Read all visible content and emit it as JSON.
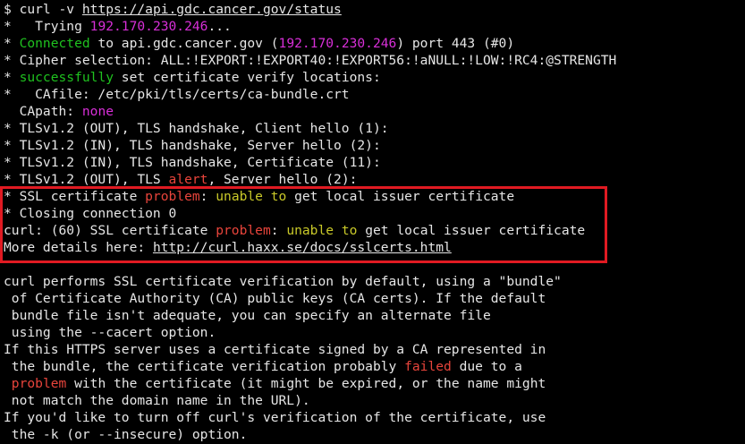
{
  "colors": {
    "background": "#000000",
    "text": "#e6e6e6",
    "green": "#1fc21f",
    "magenta": "#d82fd8",
    "red": "#e8443b",
    "yellow": "#c9c929",
    "highlight_border": "#e01a22"
  },
  "terminal": {
    "lines": [
      [
        {
          "t": "$ curl -v ",
          "c": "w"
        },
        {
          "t": "https://api.gdc.cancer.gov/status",
          "c": "w",
          "u": true
        }
      ],
      [
        {
          "t": "*   Trying ",
          "c": "w"
        },
        {
          "t": "192.170.230.246",
          "c": "m"
        },
        {
          "t": "...",
          "c": "w"
        }
      ],
      [
        {
          "t": "* ",
          "c": "w"
        },
        {
          "t": "Connected",
          "c": "g"
        },
        {
          "t": " to api.gdc.cancer.gov (",
          "c": "w"
        },
        {
          "t": "192.170.230.246",
          "c": "m"
        },
        {
          "t": ") port 443 (#0)",
          "c": "w"
        }
      ],
      [
        {
          "t": "* Cipher selection: ALL:!EXPORT:!EXPORT40:!EXPORT56:!aNULL:!LOW:!RC4:@STRENGTH",
          "c": "w"
        }
      ],
      [
        {
          "t": "* ",
          "c": "w"
        },
        {
          "t": "successfully",
          "c": "g"
        },
        {
          "t": " set certificate verify locations:",
          "c": "w"
        }
      ],
      [
        {
          "t": "*   CAfile: /etc/pki/tls/certs/ca-bundle.crt",
          "c": "w"
        }
      ],
      [
        {
          "t": "  CApath: ",
          "c": "w"
        },
        {
          "t": "none",
          "c": "m"
        }
      ],
      [
        {
          "t": "* TLSv1.2 (OUT), TLS handshake, Client hello (1):",
          "c": "w"
        }
      ],
      [
        {
          "t": "* TLSv1.2 (IN), TLS handshake, Server hello (2):",
          "c": "w"
        }
      ],
      [
        {
          "t": "* TLSv1.2 (IN), TLS handshake, Certificate (11):",
          "c": "w"
        }
      ],
      [
        {
          "t": "* TLSv1.2 (OUT), TLS ",
          "c": "w"
        },
        {
          "t": "alert",
          "c": "r"
        },
        {
          "t": ", Server hello (2):",
          "c": "w"
        }
      ],
      [
        {
          "t": "* SSL certificate ",
          "c": "w"
        },
        {
          "t": "problem",
          "c": "r"
        },
        {
          "t": ": ",
          "c": "w"
        },
        {
          "t": "unable to",
          "c": "y"
        },
        {
          "t": " get local issuer certificate",
          "c": "w"
        }
      ],
      [
        {
          "t": "* Closing connection 0",
          "c": "w"
        }
      ],
      [
        {
          "t": "curl: (60) SSL certificate ",
          "c": "w"
        },
        {
          "t": "problem",
          "c": "r"
        },
        {
          "t": ": ",
          "c": "w"
        },
        {
          "t": "unable to",
          "c": "y"
        },
        {
          "t": " get local issuer certificate",
          "c": "w"
        }
      ],
      [
        {
          "t": "More details here: ",
          "c": "w"
        },
        {
          "t": "http://curl.haxx.se/docs/sslcerts.html",
          "c": "w",
          "u": true
        }
      ],
      [
        {
          "t": "",
          "c": "w"
        }
      ],
      [
        {
          "t": "curl performs SSL certificate verification by default, using a \"bundle\"",
          "c": "w"
        }
      ],
      [
        {
          "t": " of Certificate Authority (CA) public keys (CA certs). If the default",
          "c": "w"
        }
      ],
      [
        {
          "t": " bundle file isn't adequate, you can specify an alternate file",
          "c": "w"
        }
      ],
      [
        {
          "t": " using the --cacert option.",
          "c": "w"
        }
      ],
      [
        {
          "t": "If this HTTPS server uses a certificate signed by a CA represented in",
          "c": "w"
        }
      ],
      [
        {
          "t": " the bundle, the certificate verification probably ",
          "c": "w"
        },
        {
          "t": "failed",
          "c": "r"
        },
        {
          "t": " due to a",
          "c": "w"
        }
      ],
      [
        {
          "t": " ",
          "c": "w"
        },
        {
          "t": "problem",
          "c": "r"
        },
        {
          "t": " with the certificate (it might be expired, or the name might",
          "c": "w"
        }
      ],
      [
        {
          "t": " not match the domain name in the URL).",
          "c": "w"
        }
      ],
      [
        {
          "t": "If you'd like to turn off curl's verification of the certificate, use",
          "c": "w"
        }
      ],
      [
        {
          "t": " the -k (or --insecure) option.",
          "c": "w"
        }
      ]
    ]
  }
}
